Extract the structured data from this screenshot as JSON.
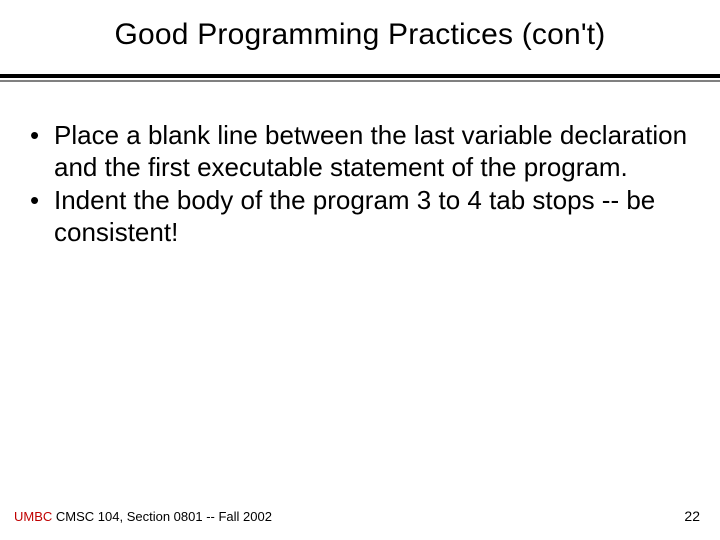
{
  "title": "Good Programming Practices (con't)",
  "bullets": [
    "Place a blank line between the last variable declaration and the first executable statement of the program.",
    "Indent the body of the program 3 to 4 tab stops -- be consistent!"
  ],
  "footer": {
    "umbc": "UMBC",
    "course": " CMSC 104, Section 0801 -- Fall 2002",
    "page": "22"
  }
}
